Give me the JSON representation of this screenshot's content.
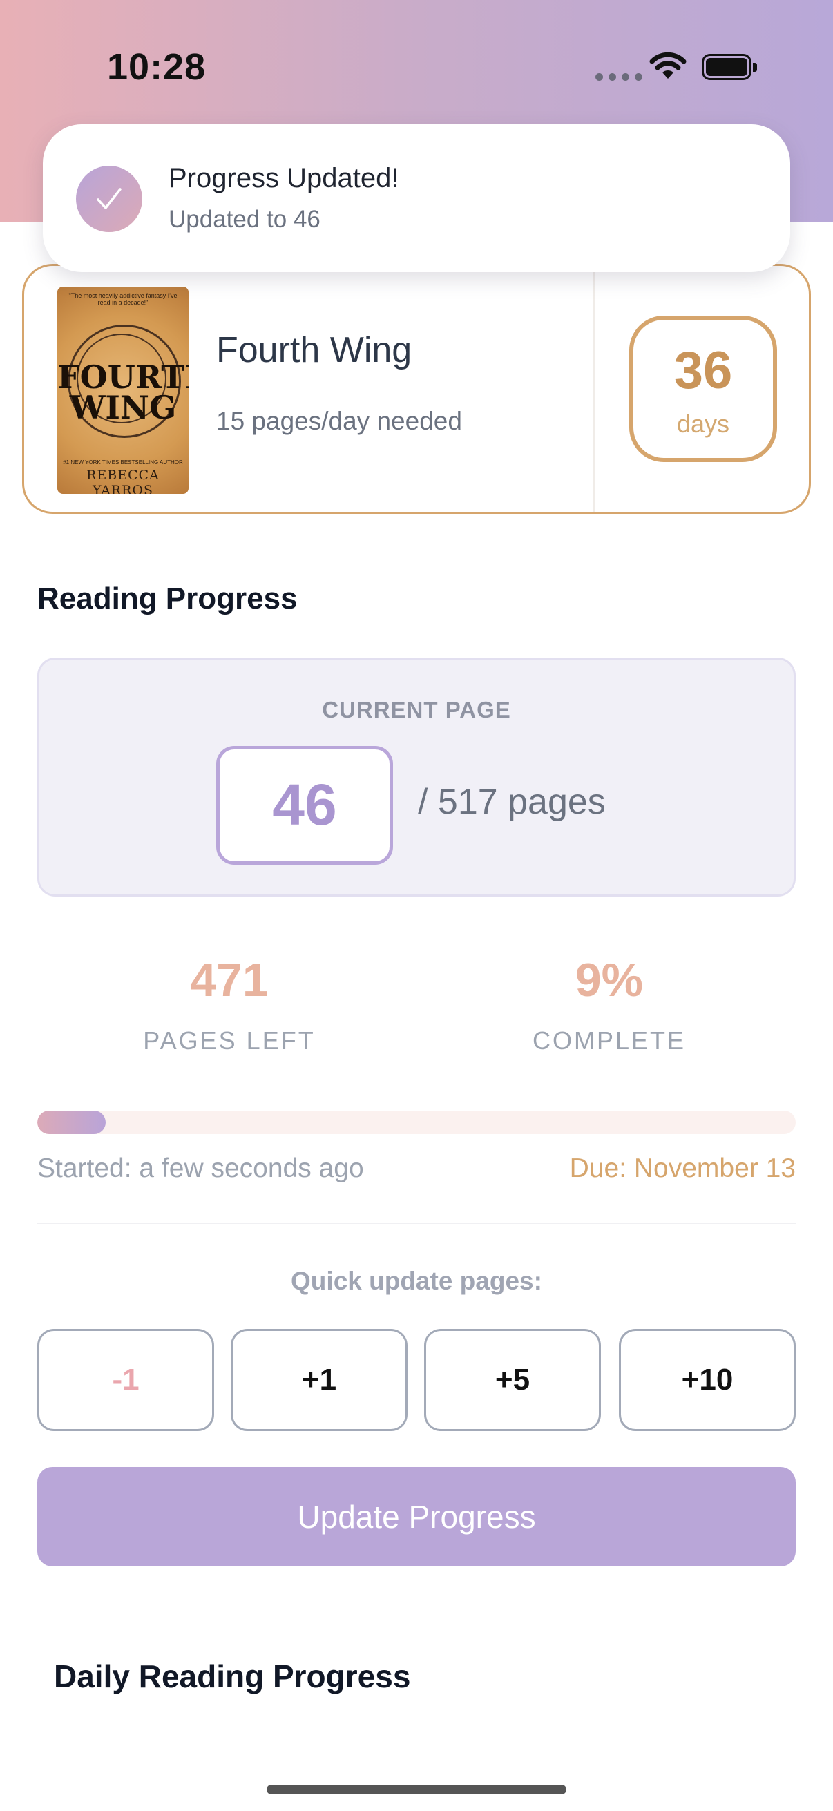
{
  "status_bar": {
    "time": "10:28"
  },
  "toast": {
    "title": "Progress Updated!",
    "subtitle": "Updated to 46"
  },
  "book": {
    "title": "Fourth Wing",
    "pages_per_day": "15 pages/day needed",
    "days_remaining": "36",
    "days_label": "days",
    "cover": {
      "tagline": "\"The most heavily addictive fantasy I've read in a decade!\"",
      "title_line1": "FOURTH",
      "title_line2": "WING",
      "blurb": "#1 NEW YORK TIMES BESTSELLING AUTHOR",
      "author": "REBECCA YARROS"
    }
  },
  "reading_progress": {
    "section_title": "Reading Progress",
    "current_page_label": "CURRENT PAGE",
    "current_page": "46",
    "total_pages_text": "/ 517 pages",
    "pages_left": "471",
    "pages_left_label": "PAGES LEFT",
    "percent_complete": "9%",
    "complete_label": "COMPLETE",
    "progress_fraction": 0.09,
    "started": "Started: a few seconds ago",
    "due": "Due: November 13"
  },
  "quick_update": {
    "label": "Quick update pages:",
    "buttons": [
      "-1",
      "+1",
      "+5",
      "+10"
    ]
  },
  "update_button_label": "Update Progress",
  "daily_section_title": "Daily Reading Progress",
  "colors": {
    "accent_purple": "#b9a6d8",
    "accent_gold": "#d6a56c",
    "accent_peach": "#e8b39e"
  }
}
